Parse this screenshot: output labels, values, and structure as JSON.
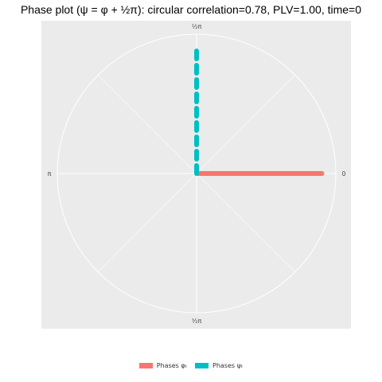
{
  "title": "Phase plot (ψ = φ + ½π): circular correlation=0.78, PLV=1.00, time=0",
  "chart_data": {
    "type": "line",
    "coordinate_system": "polar",
    "angle_ticks": [
      {
        "label": "0",
        "angle": 0
      },
      {
        "label": "½π",
        "angle": 1.5708
      },
      {
        "label": "π",
        "angle": 3.1416
      },
      {
        "label": "³⁄₂π",
        "angle": 4.7124
      }
    ],
    "radius_max": 1,
    "grid": true,
    "legend_position": "bottom",
    "series": [
      {
        "name": "Phases φₜ",
        "color": "#F8766D",
        "line_style": "solid",
        "angle": 0,
        "r": [
          0,
          1
        ]
      },
      {
        "name": "Phases ψₜ",
        "color": "#00BFC4",
        "line_style": "dashed",
        "angle": 1.5708,
        "r": [
          0,
          1
        ]
      }
    ]
  },
  "colors": {
    "panel_background": "#EBEBEB",
    "grid": "#FFFFFF"
  }
}
